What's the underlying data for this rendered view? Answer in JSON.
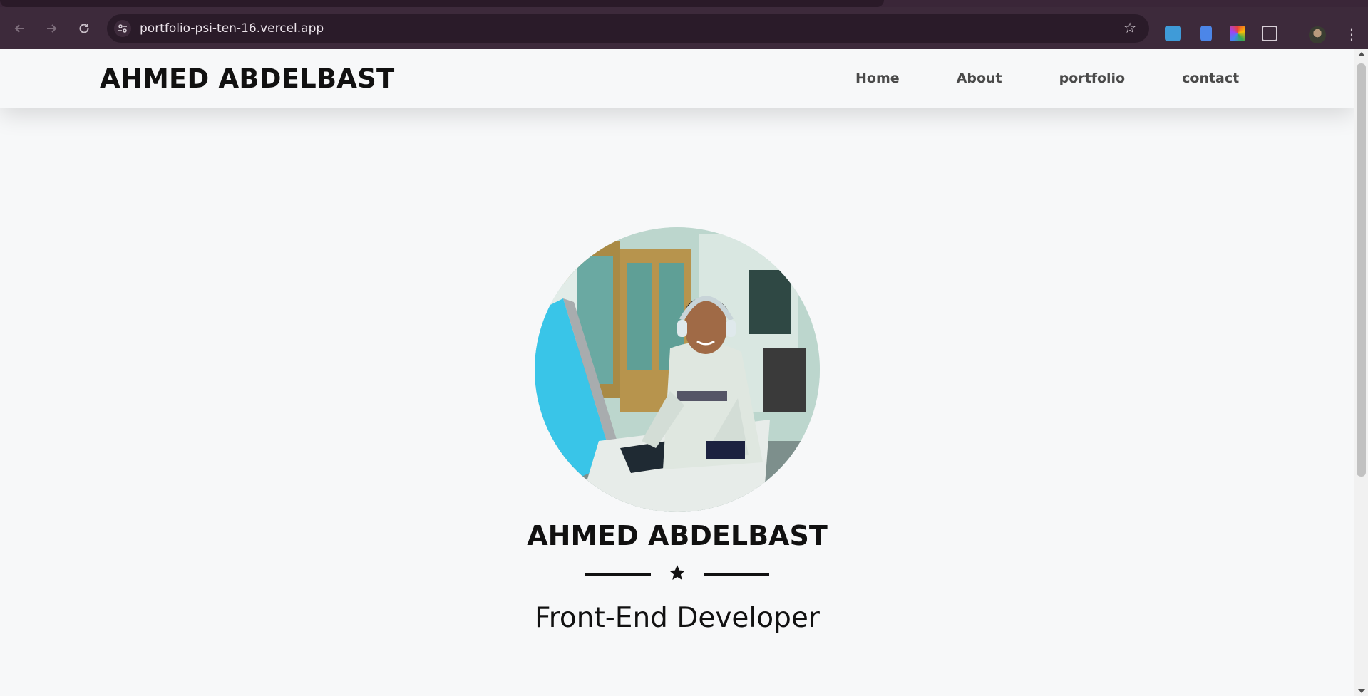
{
  "browser": {
    "url": "portfolio-psi-ten-16.vercel.app",
    "icons": {
      "back": "back-arrow-icon",
      "forward": "forward-arrow-icon",
      "reload": "reload-icon",
      "site_info": "tune-icon",
      "bookmark": "star-outline-icon",
      "menu": "kebab-menu-icon"
    }
  },
  "navbar": {
    "brand": "AHMED ABDELBAST",
    "links": [
      "Home",
      "About",
      "portfolio",
      "contact"
    ]
  },
  "hero": {
    "name": "AHMED ABDELBAST",
    "title": "Front-End Developer",
    "divider_icon": "star-icon"
  },
  "colors": {
    "page_background": "#f7f8f9",
    "text": "#111111",
    "nav_link": "#4a4a4a",
    "browser_toolbar": "#3d2a3b"
  }
}
